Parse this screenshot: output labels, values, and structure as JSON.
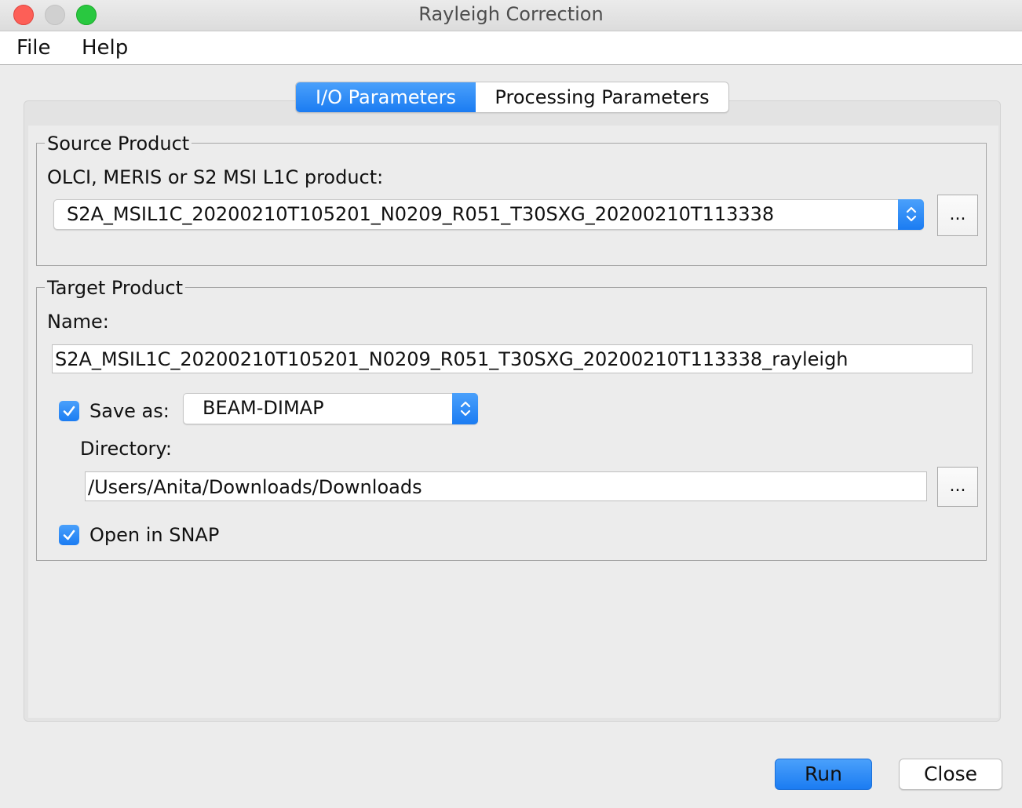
{
  "window": {
    "title": "Rayleigh Correction"
  },
  "menu": {
    "items": [
      "File",
      "Help"
    ]
  },
  "tabs": [
    {
      "label": "I/O Parameters",
      "active": true
    },
    {
      "label": "Processing Parameters",
      "active": false
    }
  ],
  "source": {
    "group_title": "Source Product",
    "label": "OLCI, MERIS or S2 MSI L1C product:",
    "selected": "S2A_MSIL1C_20200210T105201_N0209_R051_T30SXG_20200210T113338",
    "browse_label": "..."
  },
  "target": {
    "group_title": "Target Product",
    "name_label": "Name:",
    "name_value": "S2A_MSIL1C_20200210T105201_N0209_R051_T30SXG_20200210T113338_rayleigh",
    "save_as_label": "Save as:",
    "save_as_checked": true,
    "format": "BEAM-DIMAP",
    "directory_label": "Directory:",
    "directory_value": "/Users/Anita/Downloads/Downloads",
    "browse_label": "...",
    "open_label": "Open in SNAP",
    "open_checked": true
  },
  "buttons": {
    "run": "Run",
    "close": "Close"
  },
  "colors": {
    "accent": "#1b7cf2",
    "window_bg": "#ececec"
  }
}
